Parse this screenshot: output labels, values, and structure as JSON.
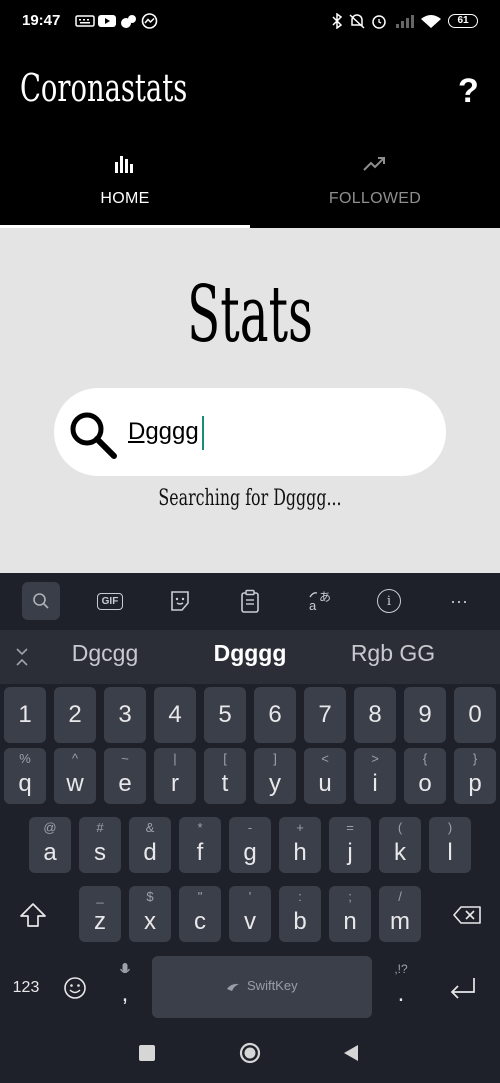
{
  "status_bar": {
    "time": "19:47",
    "battery": "61",
    "left_icons": [
      "keyboard-icon",
      "youtube-icon",
      "app-icon",
      "messenger-icon"
    ],
    "right_icons": [
      "bluetooth-icon",
      "mute-icon",
      "alarm-icon",
      "signal-icon",
      "wifi-icon"
    ]
  },
  "app": {
    "title": "Coronastats",
    "help_label": "?",
    "tabs": [
      {
        "label": "HOME",
        "icon": "bar-chart-icon",
        "selected": true
      },
      {
        "label": "FOLLOWED",
        "icon": "trending-up-icon",
        "selected": false
      }
    ]
  },
  "main": {
    "heading": "Stats",
    "search": {
      "value": "Dgggg",
      "icon": "search-icon"
    },
    "status_text": "Searching for Dgggg..."
  },
  "keyboard": {
    "toolbar": [
      {
        "name": "search",
        "label": ""
      },
      {
        "name": "gif",
        "label": "GIF"
      },
      {
        "name": "sticker",
        "label": ""
      },
      {
        "name": "clipboard",
        "label": ""
      },
      {
        "name": "translate",
        "label": ""
      },
      {
        "name": "info",
        "label": "i"
      },
      {
        "name": "more",
        "label": "···"
      }
    ],
    "suggestions": [
      "Dgcgg",
      "Dgggg",
      "Rgb GG"
    ],
    "number_row": [
      "1",
      "2",
      "3",
      "4",
      "5",
      "6",
      "7",
      "8",
      "9",
      "0"
    ],
    "row1": [
      {
        "key": "q",
        "alt": "%"
      },
      {
        "key": "w",
        "alt": "^"
      },
      {
        "key": "e",
        "alt": "~"
      },
      {
        "key": "r",
        "alt": "|"
      },
      {
        "key": "t",
        "alt": "["
      },
      {
        "key": "y",
        "alt": "]"
      },
      {
        "key": "u",
        "alt": "<"
      },
      {
        "key": "i",
        "alt": ">"
      },
      {
        "key": "o",
        "alt": "{"
      },
      {
        "key": "p",
        "alt": "}"
      }
    ],
    "row2": [
      {
        "key": "a",
        "alt": "@"
      },
      {
        "key": "s",
        "alt": "#"
      },
      {
        "key": "d",
        "alt": "&"
      },
      {
        "key": "f",
        "alt": "*"
      },
      {
        "key": "g",
        "alt": "-"
      },
      {
        "key": "h",
        "alt": "+"
      },
      {
        "key": "j",
        "alt": "="
      },
      {
        "key": "k",
        "alt": "("
      },
      {
        "key": "l",
        "alt": ")"
      }
    ],
    "row3": [
      {
        "key": "z",
        "alt": "_"
      },
      {
        "key": "x",
        "alt": "$"
      },
      {
        "key": "c",
        "alt": "\""
      },
      {
        "key": "v",
        "alt": "'"
      },
      {
        "key": "b",
        "alt": ":"
      },
      {
        "key": "n",
        "alt": ";"
      },
      {
        "key": "m",
        "alt": "/"
      }
    ],
    "bottom": {
      "numbers_label": "123",
      "comma": ",",
      "period": ".",
      "period_alt": ",!?",
      "space_label": "SwiftKey"
    }
  },
  "colors": {
    "keyboard_bg": "#1e2129",
    "key_bg": "#3b3f4a",
    "content_bg": "#e4e4e4",
    "cursor": "#1e8a7a"
  }
}
